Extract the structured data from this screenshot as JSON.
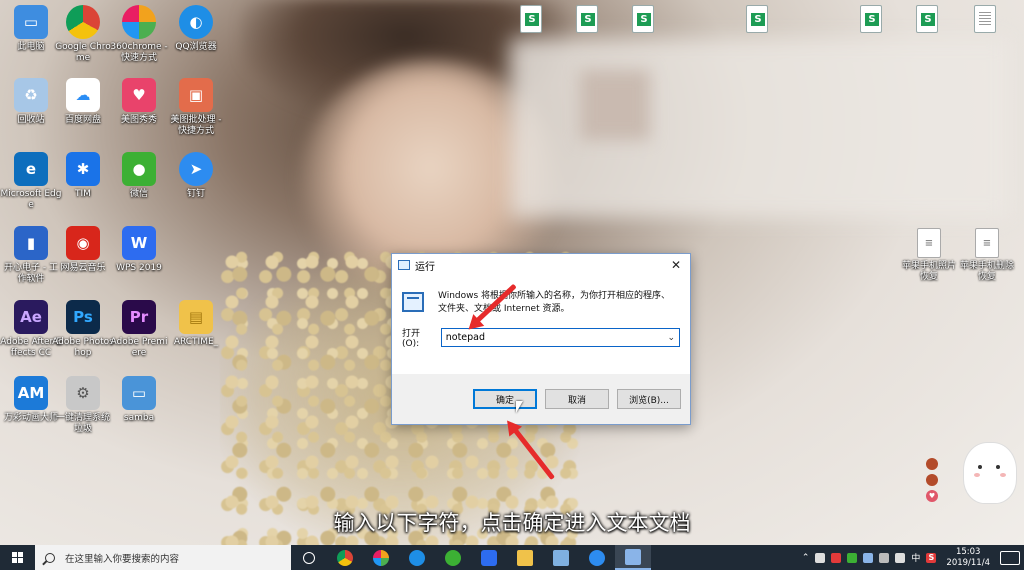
{
  "desktop_icons": [
    {
      "label": "此电脑",
      "icon": "this-pc-icon",
      "color": "#3e8de0"
    },
    {
      "label": "Google Chrome",
      "icon": "chrome-icon",
      "color": "#db4437"
    },
    {
      "label": "360chrome - 快速方式",
      "icon": "360chrome-icon",
      "color": "#f2a21d"
    },
    {
      "label": "QQ浏览器",
      "icon": "qq-browser-icon",
      "color": "#1e8ee6"
    },
    {
      "label": "回收站",
      "icon": "recycle-bin-icon",
      "color": "#a7c7e7"
    },
    {
      "label": "百度网盘",
      "icon": "baidu-netdisk-icon",
      "color": "#2a8df5"
    },
    {
      "label": "美图秀秀",
      "icon": "meitu-icon",
      "color": "#e9436b"
    },
    {
      "label": "美图批处理 - 快捷方式",
      "icon": "meitu-batch-icon",
      "color": "#e36c4b"
    },
    {
      "label": "Microsoft Edge",
      "icon": "edge-icon",
      "color": "#0d6ebd"
    },
    {
      "label": "TIM",
      "icon": "tim-icon",
      "color": "#1a73e8"
    },
    {
      "label": "微信",
      "icon": "wechat-icon",
      "color": "#3cb034"
    },
    {
      "label": "钉钉",
      "icon": "dingtalk-icon",
      "color": "#2d8cf0"
    },
    {
      "label": "开心电子 - 工作软件",
      "icon": "work-app-icon",
      "color": "#2b65c8"
    },
    {
      "label": "网易云音乐",
      "icon": "netease-music-icon",
      "color": "#d8261b"
    },
    {
      "label": "WPS 2019",
      "icon": "wps-icon",
      "color": "#2d6cf0"
    },
    {
      "label": "Adobe After Effects CC",
      "icon": "after-effects-icon",
      "color": "#2a1a5e"
    },
    {
      "label": "Adobe Photoshop",
      "icon": "photoshop-icon",
      "color": "#0c2a4a"
    },
    {
      "label": "Adobe Premiere",
      "icon": "premiere-icon",
      "color": "#2a0a4a"
    },
    {
      "label": "ARCTIME_",
      "icon": "folder-icon",
      "color": "#f0c24a"
    },
    {
      "label": "万彩动画大师",
      "icon": "animation-master-icon",
      "color": "#1c7ad8"
    },
    {
      "label": "一键清理系统垃圾",
      "icon": "cleanup-icon",
      "color": "#c8c8c8"
    },
    {
      "label": "samba",
      "icon": "samba-icon",
      "color": "#4a94d8"
    }
  ],
  "desktop_icon_text": {
    "ae": "Ae",
    "ps": "Ps",
    "pr": "Pr",
    "am": "AM",
    "e": "e",
    "w": "W"
  },
  "right_files": [
    {
      "label": "苹果手机照片恢复"
    },
    {
      "label": "苹果手机删除恢复"
    }
  ],
  "run_dialog": {
    "title": "运行",
    "close_glyph": "✕",
    "description": "Windows 将根据你所输入的名称，为你打开相应的程序、文件夹、文档或 Internet 资源。",
    "open_label": "打开(O):",
    "open_value": "notepad",
    "ok_label": "确定",
    "cancel_label": "取消",
    "browse_label": "浏览(B)..."
  },
  "subtitle": "输入以下字符，点击确定进入文本文档",
  "taskbar": {
    "search_placeholder": "在这里输入你要搜索的内容",
    "ime": "中",
    "wps_s": "S",
    "time": "15:03",
    "date": "2019/11/4"
  },
  "colors": {
    "accent": "#0078d7",
    "taskbar": "#1f2a36",
    "arrow": "#e62b2b",
    "sheet_green": "#1d9c54"
  }
}
